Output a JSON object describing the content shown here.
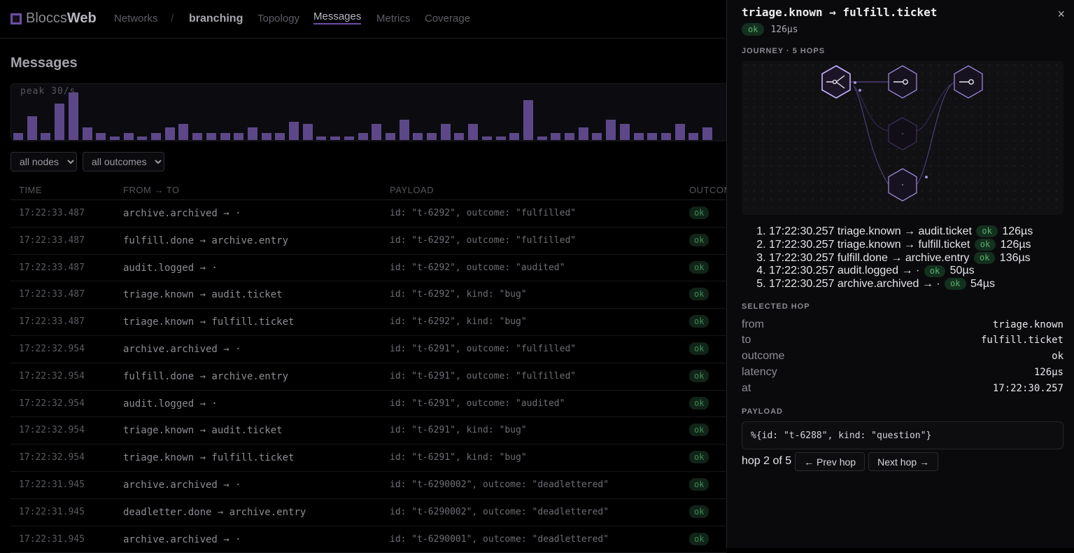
{
  "app": {
    "brand_light": "Bloccs",
    "brand_bold": "Web"
  },
  "nav": {
    "networks": "Networks",
    "separator": "/",
    "network": "branching",
    "topology": "Topology",
    "messages": "Messages",
    "metrics": "Metrics",
    "coverage": "Coverage"
  },
  "page": {
    "title": "Messages"
  },
  "chart_data": {
    "type": "bar",
    "title": "peak 30/s",
    "values": [
      4,
      13,
      4,
      20,
      26,
      7,
      4,
      2,
      4,
      2,
      4,
      7,
      9,
      4,
      4,
      4,
      4,
      7,
      4,
      4,
      10,
      9,
      2,
      2,
      2,
      4,
      9,
      4,
      11,
      4,
      4,
      9,
      4,
      9,
      2,
      2,
      4,
      22,
      2,
      4,
      4,
      7,
      4,
      11,
      9,
      4,
      4,
      4,
      9,
      4,
      7
    ],
    "ylim": [
      0,
      30
    ]
  },
  "filters": {
    "nodes": "all nodes",
    "outcomes": "all outcomes"
  },
  "table": {
    "headers": {
      "time": "TIME",
      "route": "FROM → TO",
      "payload": "PAYLOAD",
      "outcome": "OUTCOME"
    },
    "rows": [
      {
        "time": "17:22:33.487",
        "route": "archive.archived → ·",
        "payload": "id: \"t-6292\", outcome: \"fulfilled\"",
        "outcome": "ok"
      },
      {
        "time": "17:22:33.487",
        "route": "fulfill.done → archive.entry",
        "payload": "id: \"t-6292\", outcome: \"fulfilled\"",
        "outcome": "ok"
      },
      {
        "time": "17:22:33.487",
        "route": "audit.logged → ·",
        "payload": "id: \"t-6292\", outcome: \"audited\"",
        "outcome": "ok"
      },
      {
        "time": "17:22:33.487",
        "route": "triage.known → audit.ticket",
        "payload": "id: \"t-6292\", kind: \"bug\"",
        "outcome": "ok"
      },
      {
        "time": "17:22:33.487",
        "route": "triage.known → fulfill.ticket",
        "payload": "id: \"t-6292\", kind: \"bug\"",
        "outcome": "ok"
      },
      {
        "time": "17:22:32.954",
        "route": "archive.archived → ·",
        "payload": "id: \"t-6291\", outcome: \"fulfilled\"",
        "outcome": "ok"
      },
      {
        "time": "17:22:32.954",
        "route": "fulfill.done → archive.entry",
        "payload": "id: \"t-6291\", outcome: \"fulfilled\"",
        "outcome": "ok"
      },
      {
        "time": "17:22:32.954",
        "route": "audit.logged → ·",
        "payload": "id: \"t-6291\", outcome: \"audited\"",
        "outcome": "ok"
      },
      {
        "time": "17:22:32.954",
        "route": "triage.known → audit.ticket",
        "payload": "id: \"t-6291\", kind: \"bug\"",
        "outcome": "ok"
      },
      {
        "time": "17:22:32.954",
        "route": "triage.known → fulfill.ticket",
        "payload": "id: \"t-6291\", kind: \"bug\"",
        "outcome": "ok"
      },
      {
        "time": "17:22:31.945",
        "route": "archive.archived → ·",
        "payload": "id: \"t-6290002\", outcome: \"deadlettered\"",
        "outcome": "ok"
      },
      {
        "time": "17:22:31.945",
        "route": "deadletter.done → archive.entry",
        "payload": "id: \"t-6290002\", outcome: \"deadlettered\"",
        "outcome": "ok"
      },
      {
        "time": "17:22:31.945",
        "route": "archive.archived → ·",
        "payload": "id: \"t-6290001\", outcome: \"deadlettered\"",
        "outcome": "ok"
      }
    ]
  },
  "detail": {
    "title": "triage.known → fulfill.ticket",
    "status": "ok",
    "latency": "126µs",
    "close": "×",
    "journey_label": "JOURNEY · 5 HOPS",
    "hops": [
      {
        "time": "17:22:30.257",
        "route": "triage.known → audit.ticket",
        "outcome": "ok",
        "latency": "126µs"
      },
      {
        "time": "17:22:30.257",
        "route": "triage.known → fulfill.ticket",
        "outcome": "ok",
        "latency": "126µs"
      },
      {
        "time": "17:22:30.257",
        "route": "fulfill.done → archive.entry",
        "outcome": "ok",
        "latency": "136µs"
      },
      {
        "time": "17:22:30.257",
        "route": "audit.logged → ·",
        "outcome": "ok",
        "latency": "50µs"
      },
      {
        "time": "17:22:30.257",
        "route": "archive.archived → ·",
        "outcome": "ok",
        "latency": "54µs"
      }
    ],
    "selected_label": "SELECTED HOP",
    "selected": {
      "from_k": "from",
      "from_v": "triage.known",
      "to_k": "to",
      "to_v": "fulfill.ticket",
      "outcome_k": "outcome",
      "outcome_v": "ok",
      "latency_k": "latency",
      "latency_v": "126µs",
      "at_k": "at",
      "at_v": "17:22:30.257"
    },
    "payload_label": "PAYLOAD",
    "payload": "%{id: \"t-6288\", kind: \"question\"}",
    "pager": {
      "text": "hop 2 of 5",
      "prev": "← Prev hop",
      "next": "Next hop →"
    }
  },
  "colors": {
    "accent": "#6e4fa6",
    "bar": "#5c4888",
    "ok_bg": "#14301e",
    "ok_fg": "#58b070"
  }
}
